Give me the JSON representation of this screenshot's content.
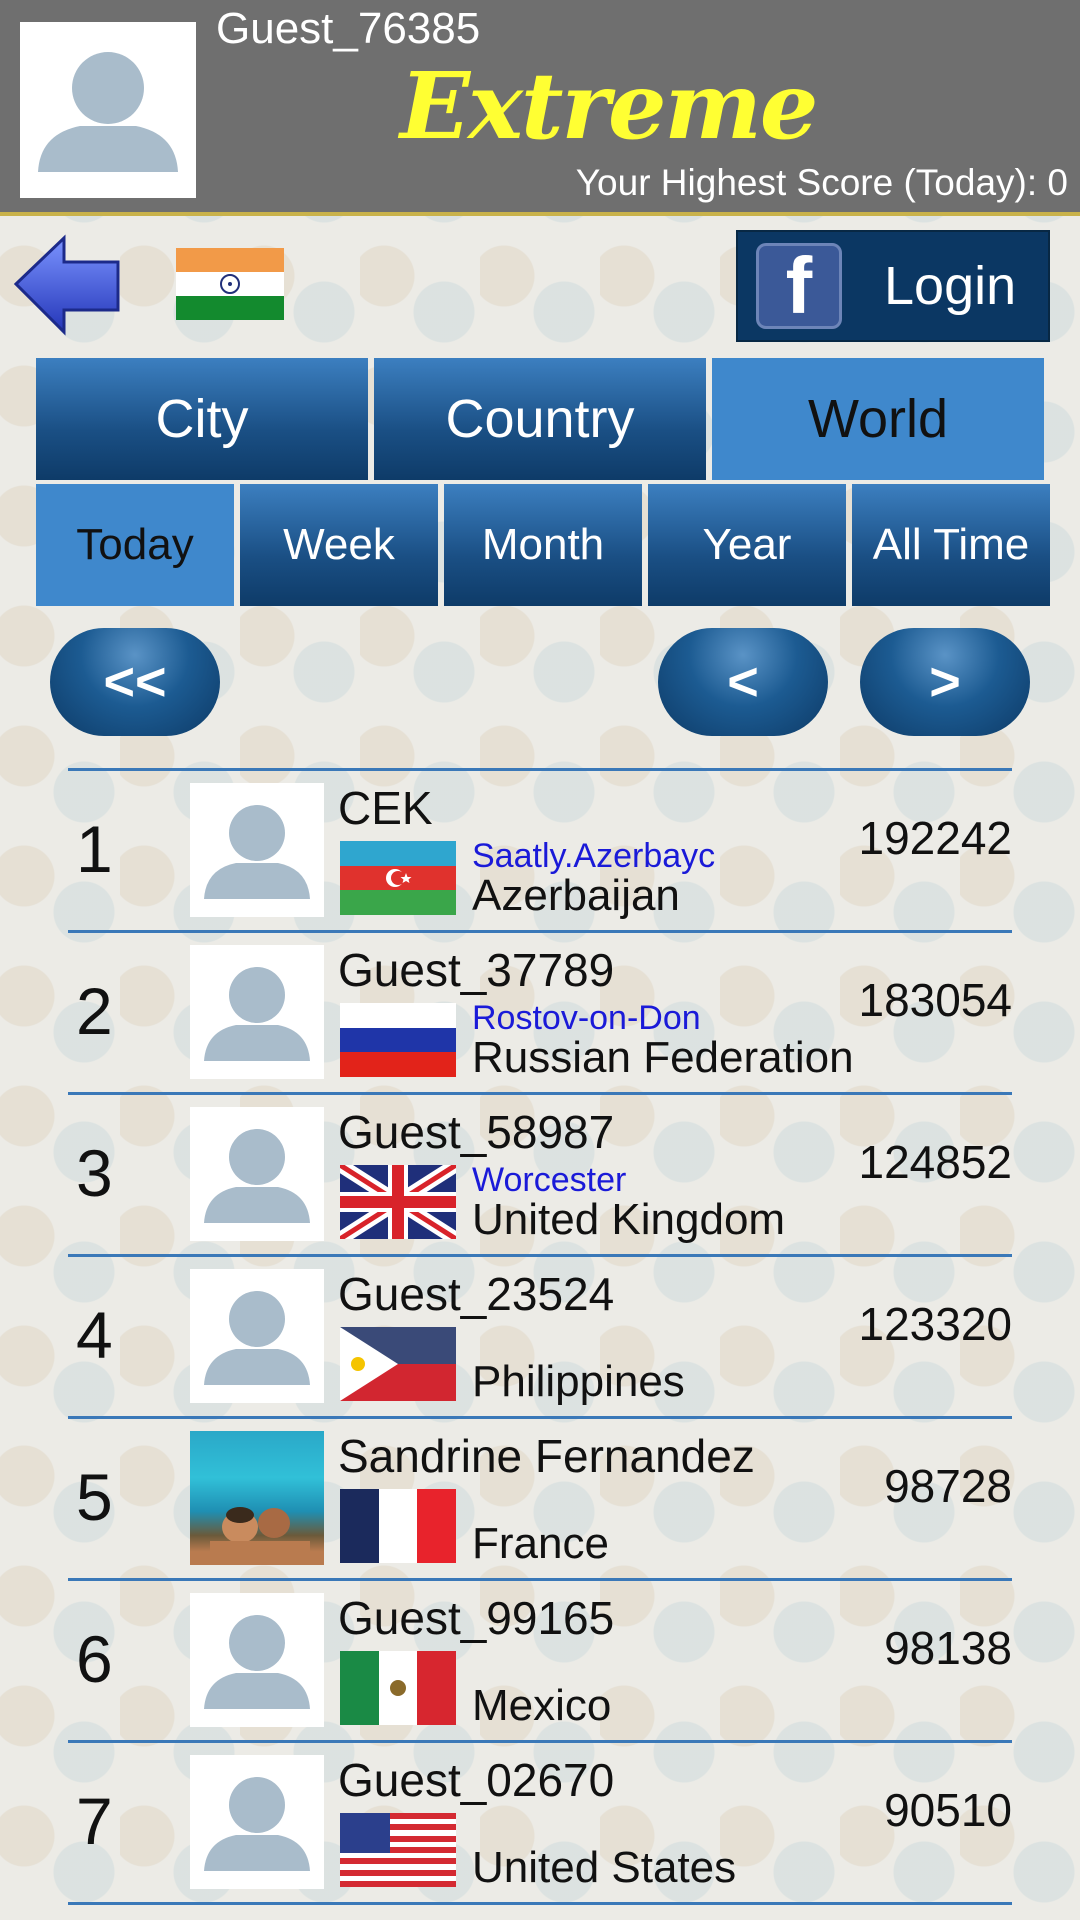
{
  "header": {
    "username": "Guest_76385",
    "brand": "Extreme",
    "highest_score": "Your Highest Score (Today): 0"
  },
  "toolbar": {
    "user_flag": "India",
    "login_label": "Login",
    "facebook_glyph": "f"
  },
  "scope_tabs": [
    {
      "label": "City",
      "active": false
    },
    {
      "label": "Country",
      "active": false
    },
    {
      "label": "World",
      "active": true
    }
  ],
  "period_tabs": [
    {
      "label": "Today",
      "active": true
    },
    {
      "label": "Week",
      "active": false
    },
    {
      "label": "Month",
      "active": false
    },
    {
      "label": "Year",
      "active": false
    },
    {
      "label": "All Time",
      "active": false
    }
  ],
  "pager": {
    "first": "<<",
    "prev": "<",
    "next": ">"
  },
  "leaderboard": [
    {
      "rank": "1",
      "name": "CEK",
      "city": "Saatly.Azerbayc",
      "country": "Azerbaijan",
      "score": "192242",
      "flag": "azerbaijan",
      "avatar": "default"
    },
    {
      "rank": "2",
      "name": "Guest_37789",
      "city": "Rostov-on-Don",
      "country": "Russian Federation",
      "score": "183054",
      "flag": "russia",
      "avatar": "default"
    },
    {
      "rank": "3",
      "name": "Guest_58987",
      "city": "Worcester",
      "country": "United Kingdom",
      "score": "124852",
      "flag": "uk",
      "avatar": "default"
    },
    {
      "rank": "4",
      "name": "Guest_23524",
      "city": "",
      "country": "Philippines",
      "score": "123320",
      "flag": "philippines",
      "avatar": "default"
    },
    {
      "rank": "5",
      "name": "Sandrine Fernandez",
      "city": "",
      "country": "France",
      "score": "98728",
      "flag": "france",
      "avatar": "photo"
    },
    {
      "rank": "6",
      "name": "Guest_99165",
      "city": "",
      "country": "Mexico",
      "score": "98138",
      "flag": "mexico",
      "avatar": "default"
    },
    {
      "rank": "7",
      "name": "Guest_02670",
      "city": "",
      "country": "United States",
      "score": "90510",
      "flag": "usa",
      "avatar": "default"
    }
  ],
  "colors": {
    "header_bg": "#6f6f6f",
    "brand": "#ffff33",
    "tab_dark": "#1a4f84",
    "tab_active": "#3f88cc",
    "separator": "#3a78b8",
    "city_link": "#1a1ad8",
    "facebook": "#3b5998"
  }
}
